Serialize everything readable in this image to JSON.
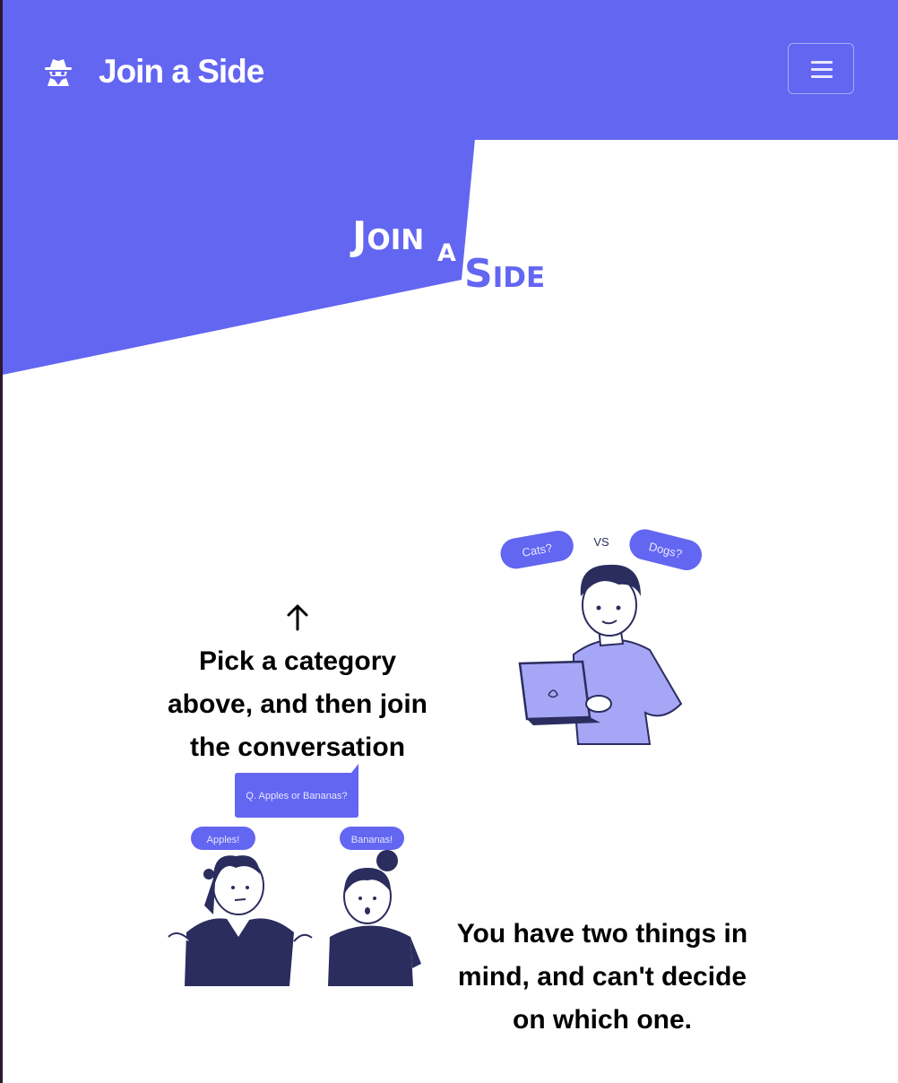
{
  "navbar": {
    "brand_icon": "spy-icon",
    "brand_text": "Join a Side",
    "menu_icon": "hamburger-menu-icon"
  },
  "logo": {
    "word1_cap": "J",
    "word1_rest": "OIN",
    "word2": "A",
    "word3_cap": "S",
    "word3_rest": "IDE"
  },
  "sections": [
    {
      "arrow_icon": "arrow-up-icon",
      "text": "Pick a category above, and then join the conversation",
      "illustration": {
        "name": "cats-vs-dogs-illustration",
        "bubble_left": "Cats?",
        "vs": "VS",
        "bubble_right": "Dogs?"
      }
    },
    {
      "text": "You have two things in mind, and can't decide on which one.",
      "illustration": {
        "name": "apples-or-bananas-illustration",
        "question": "Q. Apples or Bananas?",
        "bubble_left": "Apples!",
        "bubble_right": "Bananas!"
      }
    }
  ],
  "colors": {
    "primary": "#6366f1",
    "illustration_light": "#a5a6f6",
    "illustration_dark": "#2b2d5e",
    "white": "#ffffff"
  }
}
